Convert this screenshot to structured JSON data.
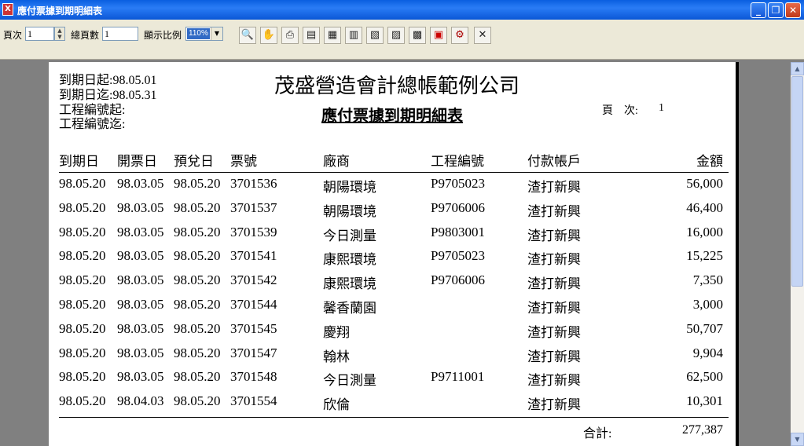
{
  "window": {
    "title": "應付票據到期明細表"
  },
  "toolbar": {
    "page_label": "頁次",
    "page_value": "1",
    "total_pages_label": "總頁數",
    "total_pages_value": "1",
    "zoom_label": "顯示比例",
    "zoom_value": "110%",
    "icons": [
      "zoom-icon",
      "hand-pan-icon",
      "print-icon",
      "document-icon",
      "export-excel-icon",
      "export-icon",
      "export-word-icon",
      "export-copy-icon",
      "export-book-icon",
      "export-pdf-icon",
      "settings-icon",
      "close-icon"
    ]
  },
  "report": {
    "company": "茂盛營造會計總帳範例公司",
    "title": "應付票據到期明細表",
    "due_from": "到期日起:98.05.01",
    "due_to": "到期日迄:98.05.31",
    "project_from": "工程編號起:",
    "project_to": "工程編號迄:",
    "page_label": "頁　次:",
    "page_value": "1",
    "columns": [
      "到期日",
      "開票日",
      "預兌日",
      "票號",
      "廠商",
      "工程編號",
      "付款帳戶",
      "金額"
    ],
    "rows": [
      [
        "98.05.20",
        "98.03.05",
        "98.05.20",
        "3701536",
        "朝陽環境",
        "P9705023",
        "渣打新興",
        "56,000"
      ],
      [
        "98.05.20",
        "98.03.05",
        "98.05.20",
        "3701537",
        "朝陽環境",
        "P9706006",
        "渣打新興",
        "46,400"
      ],
      [
        "98.05.20",
        "98.03.05",
        "98.05.20",
        "3701539",
        "今日測量",
        "P9803001",
        "渣打新興",
        "16,000"
      ],
      [
        "98.05.20",
        "98.03.05",
        "98.05.20",
        "3701541",
        "康熙環境",
        "P9705023",
        "渣打新興",
        "15,225"
      ],
      [
        "98.05.20",
        "98.03.05",
        "98.05.20",
        "3701542",
        "康熙環境",
        "P9706006",
        "渣打新興",
        "7,350"
      ],
      [
        "98.05.20",
        "98.03.05",
        "98.05.20",
        "3701544",
        "馨香蘭園",
        "",
        "渣打新興",
        "3,000"
      ],
      [
        "98.05.20",
        "98.03.05",
        "98.05.20",
        "3701545",
        "慶翔",
        "",
        "渣打新興",
        "50,707"
      ],
      [
        "98.05.20",
        "98.03.05",
        "98.05.20",
        "3701547",
        "翰林",
        "",
        "渣打新興",
        "9,904"
      ],
      [
        "98.05.20",
        "98.03.05",
        "98.05.20",
        "3701548",
        "今日測量",
        "P9711001",
        "渣打新興",
        "62,500"
      ],
      [
        "98.05.20",
        "98.04.03",
        "98.05.20",
        "3701554",
        "欣倫",
        "",
        "渣打新興",
        "10,301"
      ]
    ],
    "total_label": "合計:",
    "total_value": "277,387"
  }
}
